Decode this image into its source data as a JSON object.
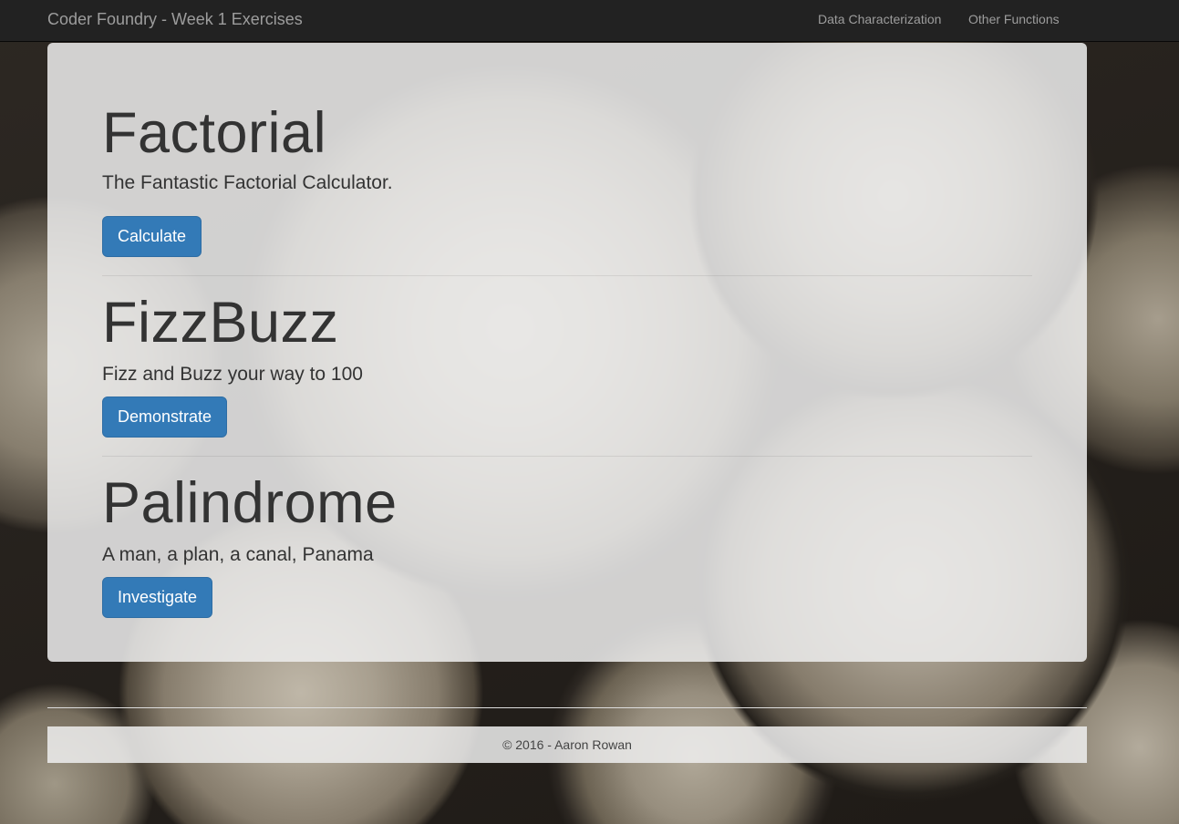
{
  "navbar": {
    "brand": "Coder Foundry - Week 1 Exercises",
    "links": [
      "Data Characterization",
      "Other Functions"
    ]
  },
  "sections": [
    {
      "title": "Factorial",
      "subtitle": "The Fantastic Factorial Calculator.",
      "button": "Calculate"
    },
    {
      "title": "FizzBuzz",
      "subtitle": "Fizz and Buzz your way to 100",
      "button": "Demonstrate"
    },
    {
      "title": "Palindrome",
      "subtitle": "A man, a plan, a canal, Panama",
      "button": "Investigate"
    }
  ],
  "footer": {
    "text": "© 2016 - Aaron Rowan"
  },
  "colors": {
    "navbar": "#222222",
    "button": "#337ab7",
    "panel": "#eeeeee"
  }
}
